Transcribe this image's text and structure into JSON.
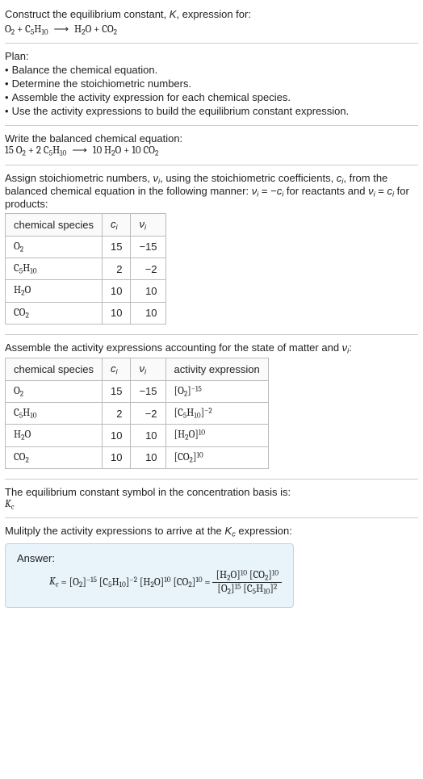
{
  "header": {
    "prompt": "Construct the equilibrium constant, K, expression for:",
    "equation_lhs": "O₂ + C₅H₁₀",
    "equation_rhs": "H₂O + CO₂"
  },
  "plan": {
    "title": "Plan:",
    "items": [
      "Balance the chemical equation.",
      "Determine the stoichiometric numbers.",
      "Assemble the activity expression for each chemical species.",
      "Use the activity expressions to build the equilibrium constant expression."
    ]
  },
  "balanced": {
    "intro": "Write the balanced chemical equation:",
    "lhs": "15 O₂ + 2 C₅H₁₀",
    "rhs": "10 H₂O + 10 CO₂"
  },
  "stoich": {
    "intro_a": "Assign stoichiometric numbers, νᵢ, using the stoichiometric coefficients, cᵢ, from the balanced chemical equation in the following manner: νᵢ = −cᵢ for reactants and νᵢ = cᵢ for products:",
    "cols": {
      "species": "chemical species",
      "c": "cᵢ",
      "v": "νᵢ"
    },
    "rows": [
      {
        "species": "O₂",
        "c": "15",
        "v": "−15"
      },
      {
        "species": "C₅H₁₀",
        "c": "2",
        "v": "−2"
      },
      {
        "species": "H₂O",
        "c": "10",
        "v": "10"
      },
      {
        "species": "CO₂",
        "c": "10",
        "v": "10"
      }
    ]
  },
  "activity": {
    "intro": "Assemble the activity expressions accounting for the state of matter and νᵢ:",
    "cols": {
      "species": "chemical species",
      "c": "cᵢ",
      "v": "νᵢ",
      "expr": "activity expression"
    },
    "rows": [
      {
        "species": "O₂",
        "c": "15",
        "v": "−15",
        "expr": "[O₂]⁻¹⁵"
      },
      {
        "species": "C₅H₁₀",
        "c": "2",
        "v": "−2",
        "expr": "[C₅H₁₀]⁻²"
      },
      {
        "species": "H₂O",
        "c": "10",
        "v": "10",
        "expr": "[H₂O]¹⁰"
      },
      {
        "species": "CO₂",
        "c": "10",
        "v": "10",
        "expr": "[CO₂]¹⁰"
      }
    ]
  },
  "kc_intro": {
    "line1": "The equilibrium constant symbol in the concentration basis is:",
    "symbol": "K_c"
  },
  "final": {
    "intro": "Mulitply the activity expressions to arrive at the K_c expression:",
    "answer_label": "Answer:",
    "kc_expr_flat": "K_c = [O₂]⁻¹⁵ [C₅H₁₀]⁻² [H₂O]¹⁰ [CO₂]¹⁰ =",
    "frac_num": "[H₂O]¹⁰ [CO₂]¹⁰",
    "frac_den": "[O₂]¹⁵ [C₅H₁₀]²"
  },
  "chart_data": {
    "type": "table",
    "tables": [
      {
        "title": "Stoichiometric numbers",
        "columns": [
          "chemical species",
          "c_i",
          "ν_i"
        ],
        "rows": [
          [
            "O2",
            15,
            -15
          ],
          [
            "C5H10",
            2,
            -2
          ],
          [
            "H2O",
            10,
            10
          ],
          [
            "CO2",
            10,
            10
          ]
        ]
      },
      {
        "title": "Activity expressions",
        "columns": [
          "chemical species",
          "c_i",
          "ν_i",
          "activity expression"
        ],
        "rows": [
          [
            "O2",
            15,
            -15,
            "[O2]^-15"
          ],
          [
            "C5H10",
            2,
            -2,
            "[C5H10]^-2"
          ],
          [
            "H2O",
            10,
            10,
            "[H2O]^10"
          ],
          [
            "CO2",
            10,
            10,
            "[CO2]^10"
          ]
        ]
      }
    ]
  }
}
